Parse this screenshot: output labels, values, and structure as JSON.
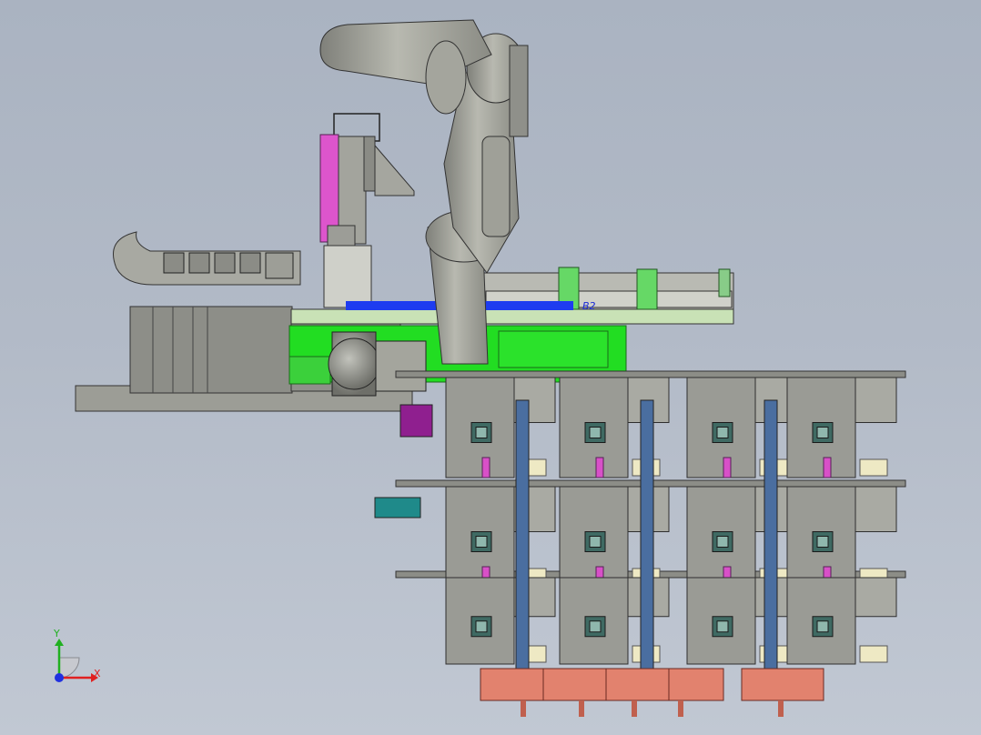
{
  "viewport": {
    "background_top": "#aab3c1",
    "background_bottom": "#c1c8d3"
  },
  "annotation": {
    "text": "B2",
    "color": "#1a2ad8"
  },
  "triad": {
    "x_label": "X",
    "y_label": "Y",
    "x_color": "#e02020",
    "y_color": "#20b020",
    "z_color": "#2030e0"
  },
  "colors": {
    "robot_gray": "#a9a9a0",
    "steel_gray": "#8f938c",
    "module_gray": "#9a9b95",
    "conveyor_green": "#22dd22",
    "plate_green": "#c9e2b6",
    "magenta": "#d850c8",
    "blue_band": "#1e3cf0",
    "teal": "#1f8a8a",
    "salmon": "#e2826e",
    "steel_blue": "#4a6ea0",
    "cream": "#eee9c4"
  }
}
